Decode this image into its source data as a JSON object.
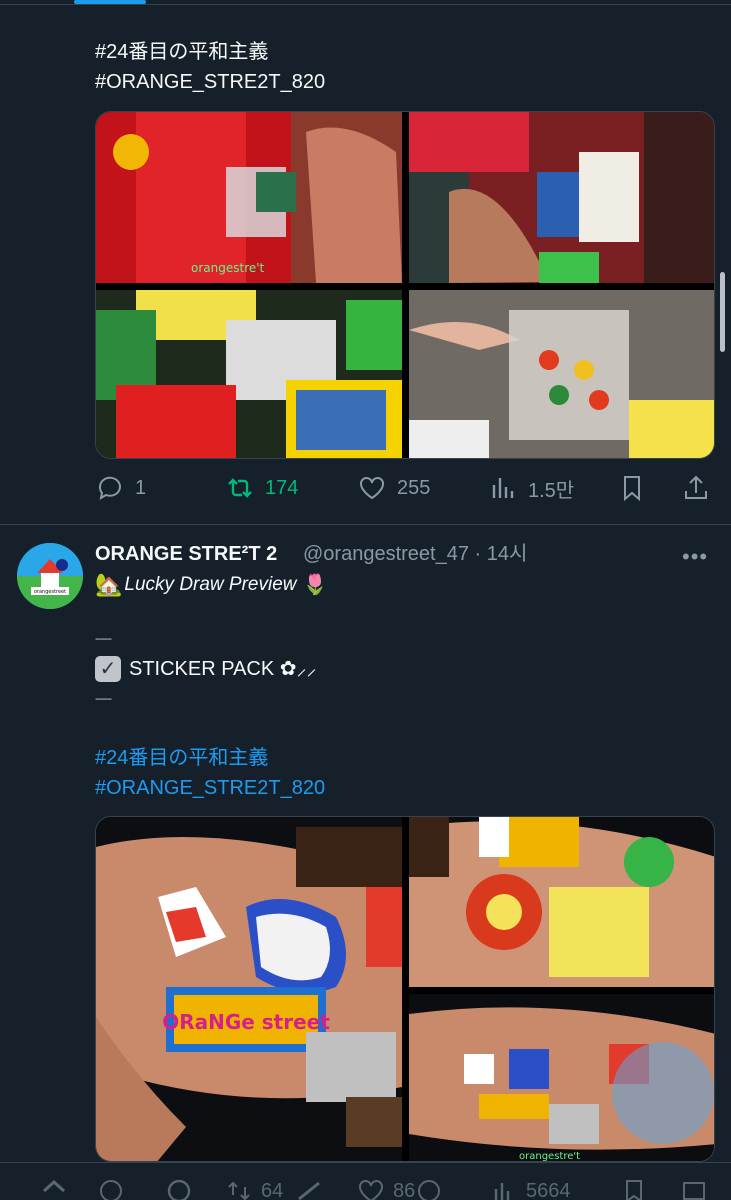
{
  "tweet1": {
    "hashtag1": "#24番目の平和主義",
    "hashtag2": "#ORANGE_STRE2T_820",
    "image_brand": "orangestre't",
    "actions": {
      "replies": "1",
      "retweets": "174",
      "likes": "255",
      "views": "1.5만"
    }
  },
  "tweet2": {
    "display_name": "ORANGE STRE²T 2",
    "handle": "@orangestreet_47 · 14시",
    "avatar_text": "orangestreet",
    "line1": "Lucky Draw Preview",
    "dash": "------",
    "line2": "STICKER PACK ✿⸝⸝",
    "hashtag1": "#24番目の平和主義",
    "hashtag2": "#ORANGE_STRE2T_820",
    "image_brand": "orangestre't",
    "sticker_text": "ORaNGe street"
  },
  "bottom_bar": {
    "retweets": "64",
    "likes": "86",
    "views": "5664"
  },
  "colors": {
    "background": "#15202b",
    "accent": "#1d9bf0",
    "retweet": "#00ba7c",
    "muted": "#8b98a5"
  }
}
